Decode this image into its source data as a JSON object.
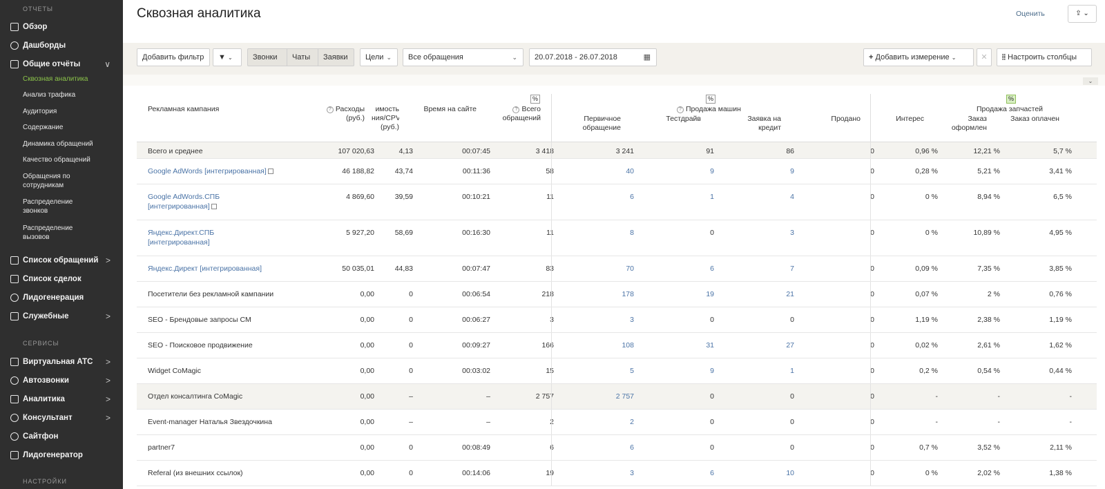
{
  "sidebar": {
    "sections": {
      "reports": "ОТЧЕТЫ",
      "services": "СЕРВИСЫ",
      "settings": "НАСТРОЙКИ"
    },
    "items": [
      {
        "label": "Обзор",
        "icon": "info-icon",
        "arrow": ""
      },
      {
        "label": "Дашборды",
        "icon": "pie-chart-icon",
        "arrow": ""
      },
      {
        "label": "Общие отчёты",
        "icon": "report-icon",
        "arrow": "∨"
      }
    ],
    "subitems": [
      {
        "label": "Сквозная аналитика",
        "active": true
      },
      {
        "label": "Анализ трафика"
      },
      {
        "label": "Аудитория"
      },
      {
        "label": "Содержание"
      },
      {
        "label": "Динамика обращений"
      },
      {
        "label": "Качество обращений"
      },
      {
        "label": "Обращения по сотрудникам"
      },
      {
        "label": "Распределение звонков"
      },
      {
        "label": "Распределение вызовов"
      }
    ],
    "items2": [
      {
        "label": "Список обращений",
        "icon": "list-icon",
        "arrow": ">"
      },
      {
        "label": "Список сделок",
        "icon": "cart-icon",
        "arrow": ""
      },
      {
        "label": "Лидогенерация",
        "icon": "leadgen-icon",
        "arrow": ""
      },
      {
        "label": "Служебные",
        "icon": "calendar-icon",
        "arrow": ">"
      }
    ],
    "services": [
      {
        "label": "Виртуальная АТС",
        "icon": "phone-icon",
        "arrow": ">"
      },
      {
        "label": "Автозвонки",
        "icon": "autocall-icon",
        "arrow": ">"
      },
      {
        "label": "Аналитика",
        "icon": "analytics-icon",
        "arrow": ">"
      },
      {
        "label": "Консультант",
        "icon": "chat-icon",
        "arrow": ">"
      },
      {
        "label": "Сайтфон",
        "icon": "sitephone-icon",
        "arrow": ""
      },
      {
        "label": "Лидогенератор",
        "icon": "leadgenerator-icon",
        "arrow": ""
      }
    ]
  },
  "header": {
    "title": "Сквозная аналитика",
    "rate_link": "Оценить"
  },
  "toolbar": {
    "add_filter": "Добавить фильтр",
    "tabs": [
      "Звонки",
      "Чаты",
      "Заявки"
    ],
    "goals": "Цели",
    "requests_select": "Все обращения",
    "date_range": "20.07.2018 - 26.07.2018",
    "add_dimension": "Добавить измерение",
    "configure_columns": "Настроить столбцы"
  },
  "table": {
    "headers": {
      "campaign": "Рекламная кампания",
      "expenses": "Расходы\n(руб.)",
      "cpv": "имость\nния/CPV\n(руб.)",
      "time_on_site": "Время на сайте",
      "total_requests": "Всего\nобращений",
      "primary": "Первичное\nобращение",
      "car_sales_group": "Продажа машин",
      "test_drive": "Тестдрайв",
      "credit_request": "Заявка на\nкредит",
      "sold": "Продано",
      "interest": "Интерес",
      "parts_sales_group": "Продажа запчастей",
      "order_placed": "Заказ\nоформлен",
      "order_paid": "Заказ оплачен",
      "pct": "%"
    },
    "rows": [
      {
        "name": "Всего и среднее",
        "link": false,
        "cal": false,
        "expenses": "107 020,63",
        "cpv": "4,13",
        "time": "00:07:45",
        "total": "3 418",
        "primary": "3 241",
        "test": "91",
        "credit": "86",
        "sold": "0",
        "interest": "0,96 %",
        "order_placed": "12,21 %",
        "order_paid": "5,7 %"
      },
      {
        "name": "Google AdWords [интегрированная]",
        "link": true,
        "cal": true,
        "expenses": "46 188,82",
        "cpv": "43,74",
        "time": "00:11:36",
        "total": "58",
        "primary": "40",
        "test": "9",
        "credit": "9",
        "sold": "0",
        "interest": "0,28 %",
        "order_placed": "5,21 %",
        "order_paid": "3,41 %"
      },
      {
        "name": "Google AdWords.СПБ\n[интегрированная]",
        "link": true,
        "cal": true,
        "expenses": "4 869,60",
        "cpv": "39,59",
        "time": "00:10:21",
        "total": "11",
        "primary": "6",
        "test": "1",
        "credit": "4",
        "sold": "0",
        "interest": "0 %",
        "order_placed": "8,94 %",
        "order_paid": "6,5 %"
      },
      {
        "name": "Яндекс.Директ.СПБ\n[интегрированная]",
        "link": true,
        "cal": false,
        "expenses": "5 927,20",
        "cpv": "58,69",
        "time": "00:16:30",
        "total": "11",
        "primary": "8",
        "test": "0",
        "credit": "3",
        "sold": "0",
        "interest": "0 %",
        "order_placed": "10,89 %",
        "order_paid": "4,95 %"
      },
      {
        "name": "Яндекс.Директ [интегрированная]",
        "link": true,
        "cal": false,
        "expenses": "50 035,01",
        "cpv": "44,83",
        "time": "00:07:47",
        "total": "83",
        "primary": "70",
        "test": "6",
        "credit": "7",
        "sold": "0",
        "interest": "0,09 %",
        "order_placed": "7,35 %",
        "order_paid": "3,85 %"
      },
      {
        "name": "Посетители без рекламной кампании",
        "link": false,
        "cal": false,
        "expenses": "0,00",
        "cpv": "0",
        "time": "00:06:54",
        "total": "218",
        "primary": "178",
        "test": "19",
        "credit": "21",
        "sold": "0",
        "interest": "0,07 %",
        "order_placed": "2 %",
        "order_paid": "0,76 %"
      },
      {
        "name": "SEO - Брендовые запросы CM",
        "link": false,
        "cal": false,
        "expenses": "0,00",
        "cpv": "0",
        "time": "00:06:27",
        "total": "3",
        "primary": "3",
        "test": "0",
        "credit": "0",
        "sold": "0",
        "interest": "1,19 %",
        "order_placed": "2,38 %",
        "order_paid": "1,19 %"
      },
      {
        "name": "SEO - Поисковое продвижение",
        "link": false,
        "cal": false,
        "expenses": "0,00",
        "cpv": "0",
        "time": "00:09:27",
        "total": "166",
        "primary": "108",
        "test": "31",
        "credit": "27",
        "sold": "0",
        "interest": "0,02 %",
        "order_placed": "2,61 %",
        "order_paid": "1,62 %"
      },
      {
        "name": "Widget CoMagic",
        "link": false,
        "cal": false,
        "expenses": "0,00",
        "cpv": "0",
        "time": "00:03:02",
        "total": "15",
        "primary": "5",
        "test": "9",
        "credit": "1",
        "sold": "0",
        "interest": "0,2 %",
        "order_placed": "0,54 %",
        "order_paid": "0,44 %"
      },
      {
        "name": "Отдел консалтинга CoMagic",
        "link": false,
        "cal": false,
        "expenses": "0,00",
        "cpv": "–",
        "time": "–",
        "total": "2 757",
        "primary": "2 757",
        "test": "0",
        "credit": "0",
        "sold": "0",
        "interest": "-",
        "order_placed": "-",
        "order_paid": "-"
      },
      {
        "name": "Event-manager Наталья Звездочкина",
        "link": false,
        "cal": false,
        "expenses": "0,00",
        "cpv": "–",
        "time": "–",
        "total": "2",
        "primary": "2",
        "test": "0",
        "credit": "0",
        "sold": "0",
        "interest": "-",
        "order_placed": "-",
        "order_paid": "-"
      },
      {
        "name": "partner7",
        "link": false,
        "cal": false,
        "expenses": "0,00",
        "cpv": "0",
        "time": "00:08:49",
        "total": "6",
        "primary": "6",
        "test": "0",
        "credit": "0",
        "sold": "0",
        "interest": "0,7 %",
        "order_placed": "3,52 %",
        "order_paid": "2,11 %"
      },
      {
        "name": "Referal (из внешних ссылок)",
        "link": false,
        "cal": false,
        "expenses": "0,00",
        "cpv": "0",
        "time": "00:14:06",
        "total": "19",
        "primary": "3",
        "test": "6",
        "credit": "10",
        "sold": "0",
        "interest": "0 %",
        "order_placed": "2,02 %",
        "order_paid": "1,38 %"
      }
    ]
  }
}
